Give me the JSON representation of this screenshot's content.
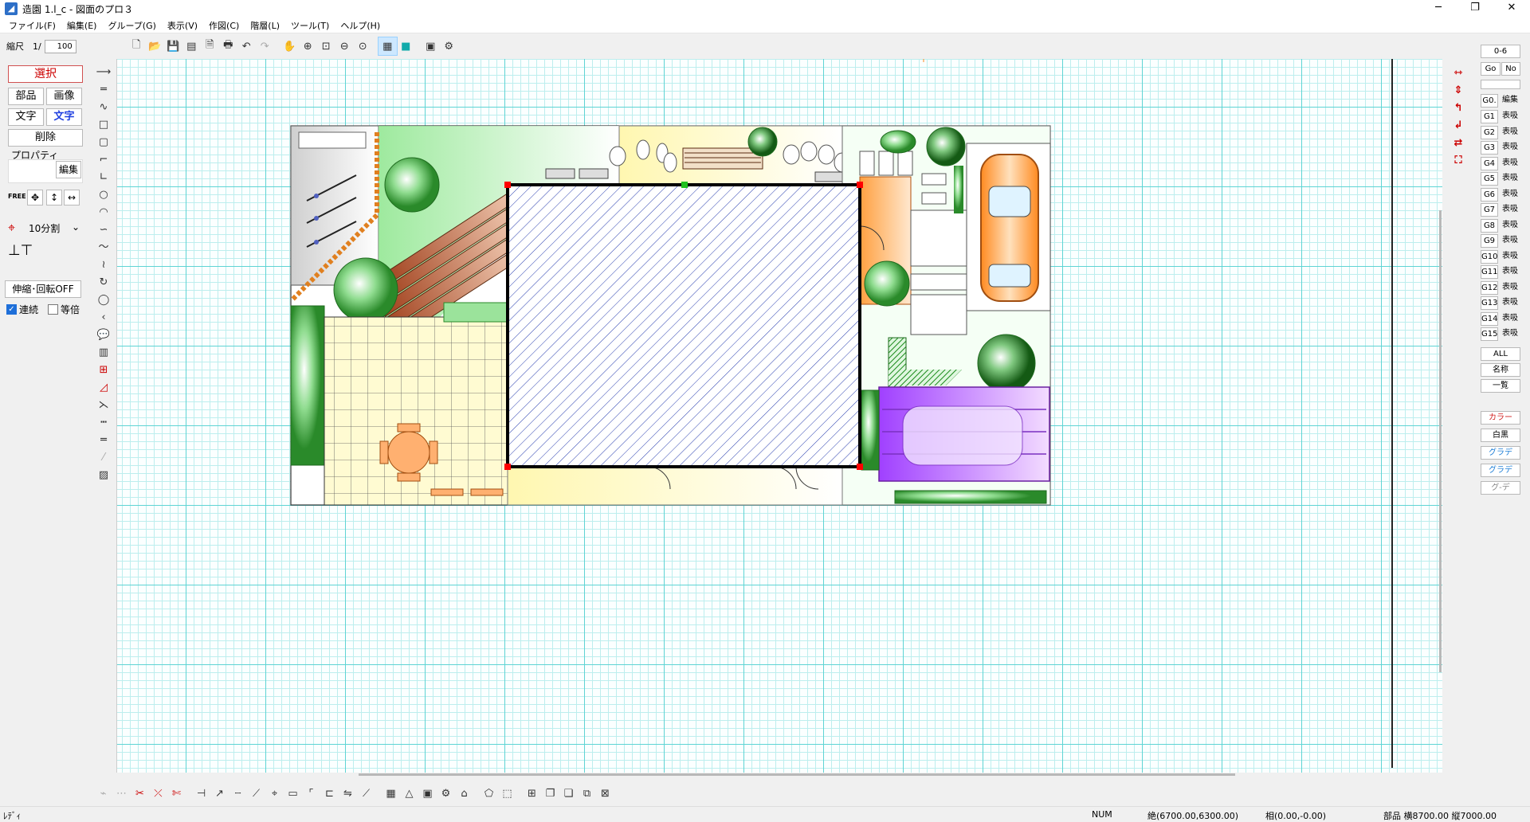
{
  "window": {
    "title": "造園 1.l_c - 図面のプロ３",
    "minimize": "─",
    "maximize": "❐",
    "close": "✕"
  },
  "menu": [
    "ファイル(F)",
    "編集(E)",
    "グループ(G)",
    "表示(V)",
    "作図(C)",
    "階層(L)",
    "ツール(T)",
    "ヘルプ(H)"
  ],
  "toolbar": {
    "scale_label": "縮尺　1/",
    "scale_value": "100"
  },
  "left_panel": {
    "select": "選択",
    "parts": "部品",
    "image": "画像",
    "text": "文字",
    "text_style": "文字",
    "delete": "削除",
    "properties": "プロパティ",
    "edit": "編集",
    "free": "FREE",
    "divide": "10分割",
    "stretch_rotate": "伸縮･回転OFF",
    "continuous": "連続",
    "equal_scale": "等倍"
  },
  "right_panel": {
    "range": "0-6",
    "go": "Go",
    "no": "No",
    "header_g": "G0.",
    "header_edit": "編集",
    "groups": [
      "G1",
      "G2",
      "G3",
      "G4",
      "G5",
      "G6",
      "G7",
      "G8",
      "G9",
      "G10",
      "G11",
      "G12",
      "G13",
      "G14",
      "G15"
    ],
    "group_state": "表吸",
    "all": "ALL",
    "name": "名称",
    "list": "一覧",
    "color": "カラー",
    "bw": "白黒",
    "grad1": "グラデ",
    "grad2": "グラデ",
    "grad3": "グ-デ"
  },
  "status": {
    "ready": "ﾚﾃﾞｨ",
    "num": "NUM",
    "absolute": "絶(6700.00,6300.00)",
    "relative": "相(0.00,-0.00)",
    "part": "部品 横8700.00 縦7000.00"
  },
  "colors": {
    "accent": "#1e6fd9",
    "grid_major": "#5fd4d4",
    "grid_minor": "#bdeeee",
    "hatch": "#2a3fb0"
  }
}
